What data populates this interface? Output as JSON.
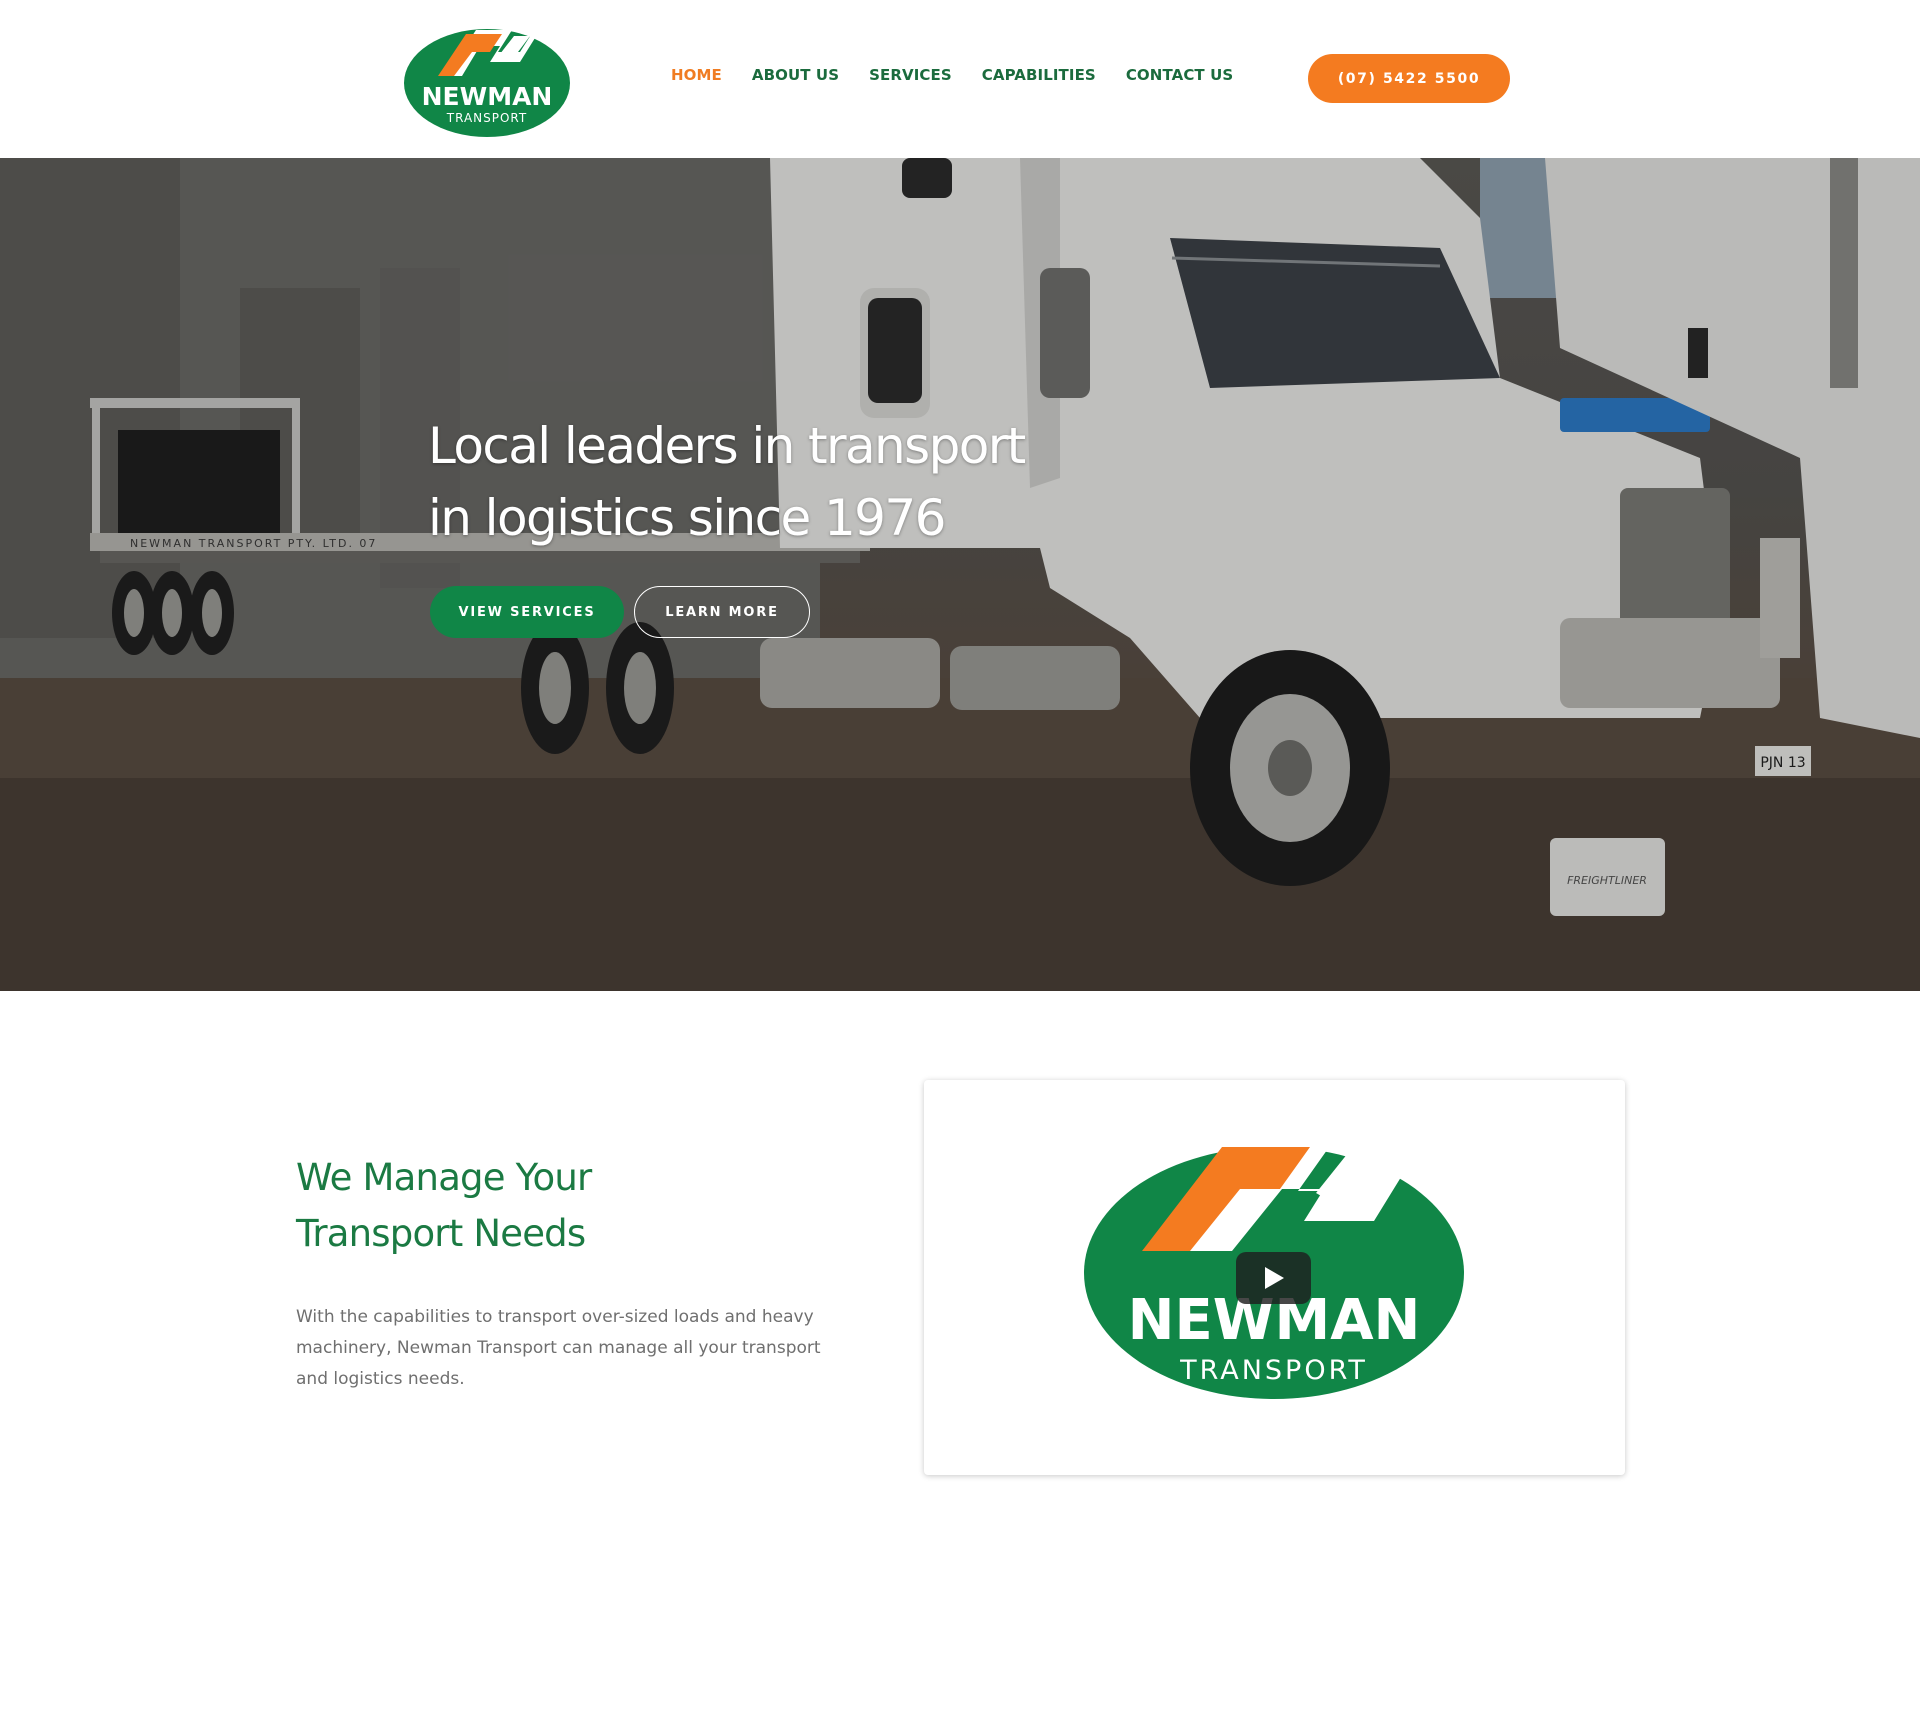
{
  "header": {
    "logo": {
      "brand": "NEWMAN",
      "sub": "TRANSPORT"
    },
    "nav": [
      {
        "label": "HOME",
        "active": true
      },
      {
        "label": "ABOUT US",
        "active": false
      },
      {
        "label": "SERVICES",
        "active": false
      },
      {
        "label": "CAPABILITIES",
        "active": false
      },
      {
        "label": "CONTACT US",
        "active": false
      }
    ],
    "phone_label": "(07) 5422 5500"
  },
  "hero": {
    "title_line1": "Local leaders in transport",
    "title_line2": "in logistics since 1976",
    "primary_button": "VIEW SERVICES",
    "secondary_button": "LEARN MORE",
    "trailer_text": "NEWMAN TRANSPORT PTY. LTD. 07",
    "plate_text": "PJN 13",
    "mudflap_text": "FREIGHTLINER"
  },
  "intro": {
    "title_line1": "We  Manage Your",
    "title_line2": "Transport  Needs",
    "body": "With the capabilities to transport over-sized loads and heavy machinery,  Newman Transport can manage all your transport and logistics needs."
  },
  "video": {
    "logo_brand": "NEWMAN",
    "logo_sub": "TRANSPORT"
  },
  "colors": {
    "brand_green": "#108647",
    "nav_green": "#1b6b3d",
    "accent_orange": "#f47b20",
    "body_gray": "#6f6f6f"
  },
  "icons": {
    "play": "play-icon"
  }
}
